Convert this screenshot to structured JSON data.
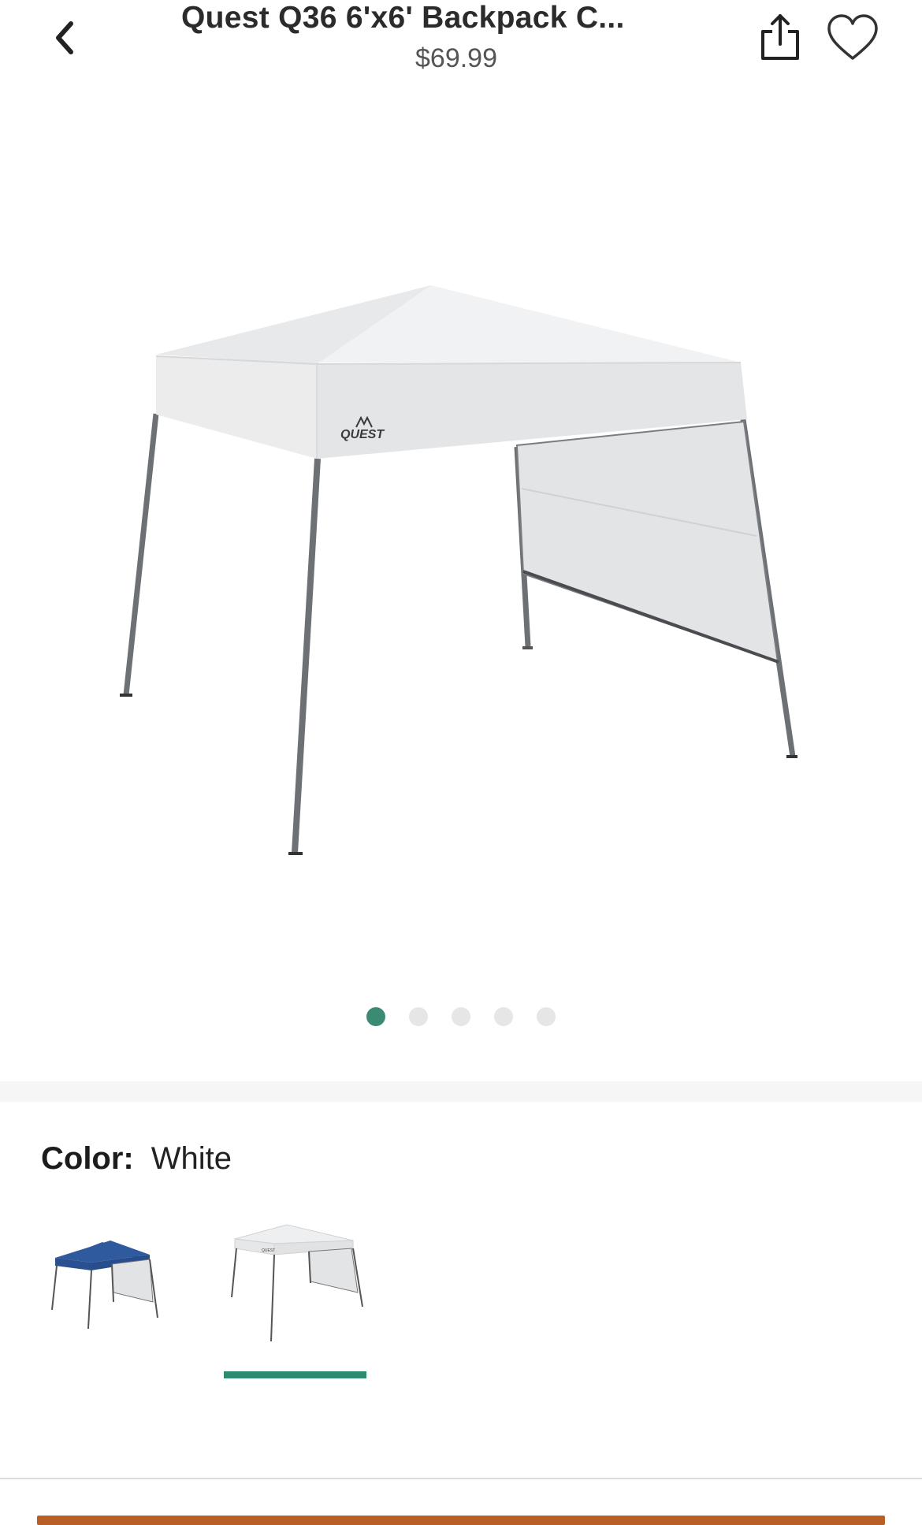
{
  "header": {
    "title": "Quest Q36 6'x6' Backpack C...",
    "price": "$69.99",
    "back_icon": "chevron-left-icon",
    "share_icon": "share-icon",
    "favorite_icon": "heart-icon"
  },
  "gallery": {
    "image_count": 5,
    "active_index": 0,
    "logo_text": "QUEST"
  },
  "color": {
    "label": "Color:",
    "selected": "White",
    "options": [
      {
        "name": "Blue",
        "swatch": "#2f5a9e"
      },
      {
        "name": "White",
        "swatch": "#e9eaeb"
      }
    ]
  },
  "colors": {
    "accent": "#3a8a74",
    "cta": "#b75f27"
  }
}
